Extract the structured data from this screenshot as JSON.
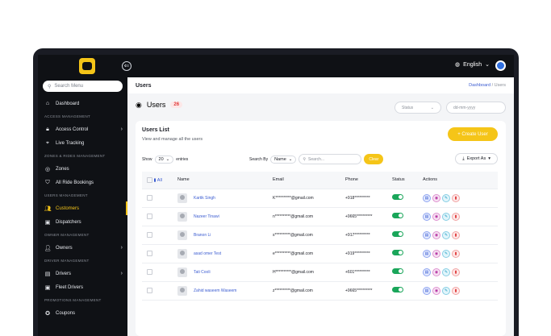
{
  "app": {
    "language": "English"
  },
  "sidebar": {
    "search_placeholder": "Search Menu",
    "dashboard": "Dashboard",
    "sec_access": "ACCESS MANAGEMENT",
    "access_control": "Access Control",
    "live_tracking": "Live Tracking",
    "sec_zones": "ZONES & RIDES MANAGEMENT",
    "zones": "Zones",
    "all_ride_bookings": "All Ride Bookings",
    "sec_users": "USERS MANAGEMENT",
    "customers": "Customers",
    "dispatchers": "Dispatchers",
    "sec_owner": "OWNER MANAGEMENT",
    "owners": "Owners",
    "sec_driver": "DRIVER MANAGEMENT",
    "drivers": "Drivers",
    "fleet_drivers": "Fleet Drivers",
    "sec_promotions": "PROMOTIONS MANAGEMENT",
    "coupons": "Coupons"
  },
  "header": {
    "title": "Users",
    "breadcrumb_link": "Dashboard",
    "breadcrumb_sep": "/",
    "breadcrumb_current": "Users"
  },
  "page": {
    "title": "Users",
    "count": "26",
    "status_placeholder": "Status",
    "date_placeholder": "dd-mm-yyyy"
  },
  "card": {
    "title": "Users List",
    "subtitle": "View and manage all the users",
    "create_label": "+ Create User",
    "show_label": "Show",
    "show_value": "20",
    "entries_label": "entries",
    "search_by_label": "Search By",
    "search_by_value": "Name",
    "search_placeholder": "Search...",
    "clear_label": "Clear",
    "export_label": "Export As"
  },
  "table": {
    "headers": {
      "select": "All",
      "name": "Name",
      "email": "Email",
      "phone": "Phone",
      "status": "Status",
      "actions": "Actions"
    },
    "rows": [
      {
        "name": "Kartik Singh",
        "email": "K**********@gmail.com",
        "phone": "+918**********"
      },
      {
        "name": "Nazeer Tinawi",
        "email": "n**********@gmail.com",
        "phone": "+9665**********"
      },
      {
        "name": "Branon Li",
        "email": "s**********@gmail.com",
        "phone": "+917**********"
      },
      {
        "name": "asad omer Test",
        "email": "e**********@gmail.com",
        "phone": "+919**********"
      },
      {
        "name": "Tati Cooli",
        "email": "H**********@gmail.com",
        "phone": "+601**********"
      },
      {
        "name": "Zahid waseem Waseem",
        "email": "z**********@gmail.com",
        "phone": "+9665**********"
      }
    ]
  },
  "colors": {
    "accent": "#f5c518",
    "sidebar_bg": "#0f1115",
    "active_toggle": "#1aa65a",
    "link": "#3b5cd1"
  },
  "icons": [
    "home-icon",
    "lock-icon",
    "location-icon",
    "target-icon",
    "shield-icon",
    "users-icon",
    "id-card-icon",
    "user-icon",
    "car-icon",
    "ticket-icon",
    "globe-icon",
    "view-icon",
    "eye-icon",
    "edit-icon",
    "delete-icon",
    "download-icon",
    "search-icon",
    "calendar-icon"
  ]
}
